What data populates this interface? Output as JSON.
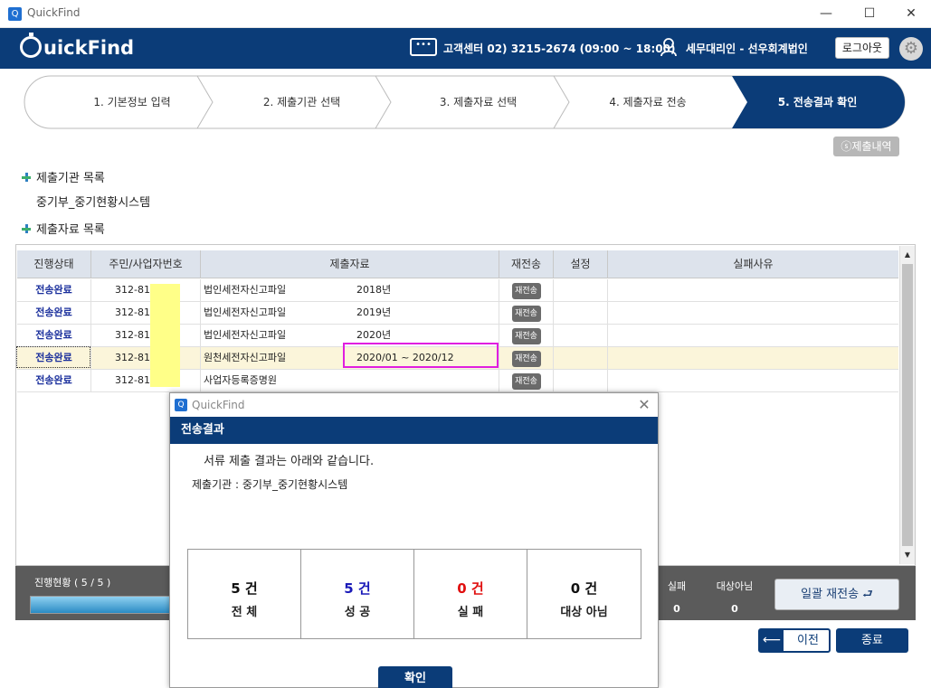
{
  "window": {
    "title": "QuickFind",
    "icon": "app-icon",
    "min": "—",
    "max": "☐",
    "close": "✕"
  },
  "header": {
    "logo_text": "uickFind",
    "support_text": "고객센터 02) 3215-2674 (09:00 ~ 18:00)",
    "user_text": "세무대리인 - 선우회계법인",
    "logout_label": "로그아웃"
  },
  "steps": [
    {
      "label": "1. 기본정보 입력"
    },
    {
      "label": "2. 제출기관 선택"
    },
    {
      "label": "3. 제출자료 선택"
    },
    {
      "label": "4. 제출자료 전송"
    },
    {
      "label": "5. 전송결과 확인",
      "active": true
    }
  ],
  "history_button": "ⓢ제출내역",
  "org_section_title": "제출기관 목록",
  "org_name": "중기부_중기현황시스템",
  "data_section_title": "제출자료 목록",
  "table": {
    "headers": [
      "진행상태",
      "주민/사업자번호",
      "제출자료",
      "재전송",
      "설정",
      "실패사유"
    ],
    "rows": [
      {
        "status": "전송완료",
        "id": "312-81-",
        "doc": "법인세전자신고파일",
        "period": "2018년",
        "resend": "재전송"
      },
      {
        "status": "전송완료",
        "id": "312-81-",
        "doc": "법인세전자신고파일",
        "period": "2019년",
        "resend": "재전송"
      },
      {
        "status": "전송완료",
        "id": "312-81-",
        "doc": "법인세전자신고파일",
        "period": "2020년",
        "resend": "재전송"
      },
      {
        "status": "전송완료",
        "id": "312-81-",
        "doc": "원천세전자신고파일",
        "period": "2020/01 ~ 2020/12",
        "resend": "재전송"
      },
      {
        "status": "전송완료",
        "id": "312-81-",
        "doc": "사업자등록증명원",
        "period": "",
        "resend": "재전송"
      }
    ]
  },
  "progress": {
    "label": "진행현황 (  5  / 5   )",
    "fraction": 1.0
  },
  "stats": {
    "fail_label": "실패",
    "fail_value": "0",
    "na_label": "대상아님",
    "na_value": "0"
  },
  "bulk_resend_label": "일괄 재전송 ⮐",
  "prev_label": "이전",
  "end_label": "종료",
  "dialog": {
    "title": "QuickFind",
    "header": "전송결과",
    "message": "서류 제출 결과는 아래와 같습니다.",
    "org_line": "제출기관 : 중기부_중기현황시스템",
    "results": [
      {
        "count": "5 건",
        "label": "전 체",
        "color": "#111111"
      },
      {
        "count": "5 건",
        "label": "성 공",
        "color": "#1a1ab8"
      },
      {
        "count": "0 건",
        "label": "실 패",
        "color": "#e01010"
      },
      {
        "count": "0 건",
        "label": "대상 아님",
        "color": "#111111"
      }
    ],
    "ok_label": "확인"
  }
}
